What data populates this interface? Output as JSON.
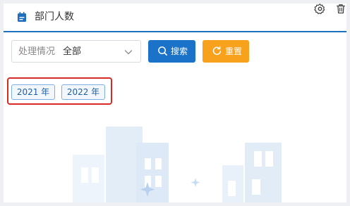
{
  "panel": {
    "title": "部门人数"
  },
  "filter": {
    "label": "处理情况",
    "value": "全部"
  },
  "buttons": {
    "search_label": "搜索",
    "reset_label": "重置"
  },
  "year_tags": [
    {
      "label": "2021 年"
    },
    {
      "label": "2022 年"
    }
  ],
  "icons": {
    "title": "calendar-icon",
    "settings": "gear-icon",
    "delete": "trash-icon",
    "dropdown": "chevron-down-icon",
    "search": "search-icon",
    "reset": "refresh-icon"
  },
  "colors": {
    "header_rule": "#1f6fbf",
    "primary_button": "#1a73c9",
    "warning_button": "#f7a11c",
    "highlight_border": "#d62a24",
    "tag_border": "#7faee0",
    "tag_text": "#1f5fa3"
  }
}
